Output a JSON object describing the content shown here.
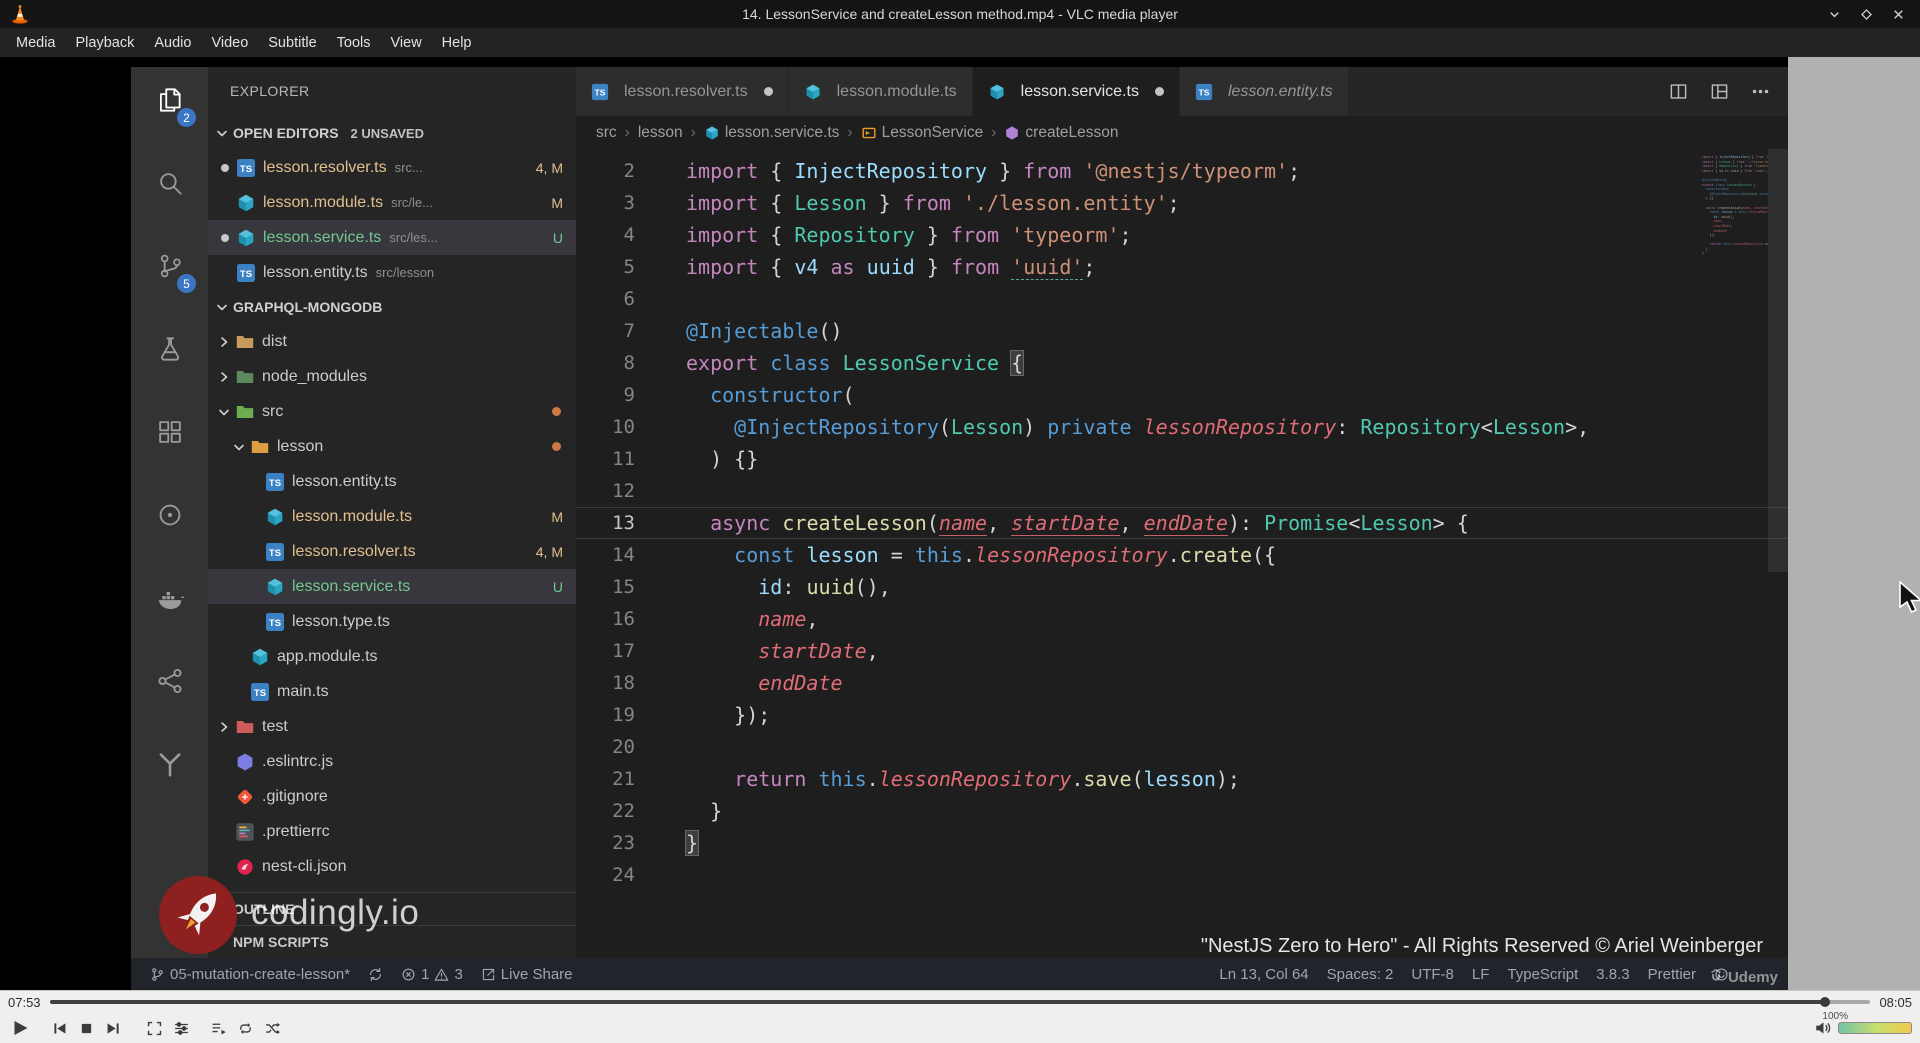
{
  "window": {
    "title": "14. LessonService and createLesson method.mp4 - VLC media player"
  },
  "menu_bar": [
    "Media",
    "Playback",
    "Audio",
    "Video",
    "Subtitle",
    "Tools",
    "View",
    "Help"
  ],
  "player": {
    "time_elapsed": "07:53",
    "time_total": "08:05",
    "progress_pct": 97.5,
    "volume_label": "100%",
    "controls": [
      "play",
      "previous",
      "stop",
      "next",
      "fullscreen",
      "extended-settings",
      "playlist",
      "loop",
      "random"
    ]
  },
  "overlays": {
    "codingly": "codingly.io",
    "copyright": "\"NestJS Zero to Hero\" - All Rights Reserved © Ariel Weinberger",
    "udemy": "Udemy"
  },
  "colors": {
    "badge_blue": "#3a76c4",
    "modified": "#e2c08d",
    "untracked": "#73c991",
    "selection": "#37373d"
  },
  "vscode": {
    "activity_bar": [
      {
        "icon": "files",
        "badge": "2",
        "active": true
      },
      {
        "icon": "search"
      },
      {
        "icon": "source-control",
        "badge": "5"
      },
      {
        "icon": "test-flask"
      },
      {
        "icon": "extensions"
      },
      {
        "icon": "circle-dot"
      },
      {
        "icon": "docker"
      },
      {
        "icon": "share-nodes"
      },
      {
        "icon": "terraform"
      }
    ],
    "explorer": {
      "title": "EXPLORER",
      "open_editors_label": "OPEN EDITORS",
      "unsaved_badge": "2 UNSAVED",
      "open_editors": [
        {
          "dirty": true,
          "icon": "ts-file",
          "name": "lesson.resolver.ts",
          "path": "src...",
          "badge": "4, M",
          "color": "mod"
        },
        {
          "dirty": false,
          "icon": "nest-file",
          "name": "lesson.module.ts",
          "path": "src/le...",
          "badge": "M",
          "color": "mod"
        },
        {
          "dirty": true,
          "icon": "nest-file",
          "name": "lesson.service.ts",
          "path": "src/les...",
          "badge": "U",
          "color": "unt",
          "selected": true
        },
        {
          "dirty": false,
          "icon": "ts-file",
          "name": "lesson.entity.ts",
          "path": "src/lesson",
          "badge": "",
          "color": "norm"
        }
      ],
      "project_label": "GRAPHQL-MONGODB",
      "tree": [
        {
          "indent": 0,
          "chevron": "right",
          "icon": "folder-dist",
          "name": "dist"
        },
        {
          "indent": 0,
          "chevron": "right",
          "icon": "folder-node-modules",
          "name": "node_modules"
        },
        {
          "indent": 0,
          "chevron": "down",
          "icon": "folder-src",
          "name": "src",
          "dot": true
        },
        {
          "indent": 1,
          "chevron": "down",
          "icon": "folder-lesson",
          "name": "lesson",
          "dot": true
        },
        {
          "indent": 2,
          "icon": "ts-file",
          "name": "lesson.entity.ts",
          "color": "norm"
        },
        {
          "indent": 2,
          "icon": "nest-file",
          "name": "lesson.module.ts",
          "badge": "M",
          "color": "mod"
        },
        {
          "indent": 2,
          "icon": "ts-file",
          "name": "lesson.resolver.ts",
          "badge": "4, M",
          "color": "mod"
        },
        {
          "indent": 2,
          "icon": "nest-file",
          "name": "lesson.service.ts",
          "badge": "U",
          "color": "unt",
          "selected": true
        },
        {
          "indent": 2,
          "icon": "ts-file",
          "name": "lesson.type.ts",
          "color": "norm"
        },
        {
          "indent": 1,
          "icon": "nest-file",
          "name": "app.module.ts",
          "color": "norm"
        },
        {
          "indent": 1,
          "icon": "ts-file",
          "name": "main.ts",
          "color": "norm"
        },
        {
          "indent": 0,
          "chevron": "right",
          "icon": "folder-test",
          "name": "test"
        },
        {
          "indent": 0,
          "icon": "eslint-file",
          "name": ".eslintrc.js",
          "color": "norm"
        },
        {
          "indent": 0,
          "icon": "git-file",
          "name": ".gitignore",
          "color": "norm"
        },
        {
          "indent": 0,
          "icon": "prettier-file",
          "name": ".prettierrc",
          "color": "norm"
        },
        {
          "indent": 0,
          "icon": "nest-cli-file",
          "name": "nest-cli.json",
          "color": "norm"
        }
      ],
      "bottom_sections": [
        "OUTLINE",
        "NPM SCRIPTS"
      ]
    },
    "tabs": [
      {
        "icon": "ts-file",
        "label": "lesson.resolver.ts",
        "dirty": true
      },
      {
        "icon": "nest-file",
        "label": "lesson.module.ts"
      },
      {
        "icon": "nest-file",
        "label": "lesson.service.ts",
        "dirty": true,
        "active": true
      },
      {
        "icon": "ts-file",
        "label": "lesson.entity.ts",
        "preview": true
      }
    ],
    "breadcrumbs": [
      {
        "label": "src"
      },
      {
        "label": "lesson"
      },
      {
        "label": "lesson.service.ts",
        "icon": "nest-file"
      },
      {
        "label": "LessonService",
        "icon": "symbol-class"
      },
      {
        "label": "createLesson",
        "icon": "symbol-method"
      }
    ],
    "editor": {
      "current_line": 13,
      "lines": [
        {
          "n": 2,
          "t": [
            [
              "import",
              "k1"
            ],
            [
              " { ",
              "pu"
            ],
            [
              "InjectRepository",
              "vb"
            ],
            [
              " } ",
              "pu"
            ],
            [
              "from",
              "k1"
            ],
            [
              " ",
              "pu"
            ],
            [
              "'@nestjs/typeorm'",
              "st"
            ],
            [
              ";",
              "pu"
            ]
          ]
        },
        {
          "n": 3,
          "t": [
            [
              "import",
              "k1"
            ],
            [
              " { ",
              "pu"
            ],
            [
              "Lesson",
              "ty"
            ],
            [
              " } ",
              "pu"
            ],
            [
              "from",
              "k1"
            ],
            [
              " ",
              "pu"
            ],
            [
              "'./lesson.entity'",
              "st"
            ],
            [
              ";",
              "pu"
            ]
          ]
        },
        {
          "n": 4,
          "t": [
            [
              "import",
              "k1"
            ],
            [
              " { ",
              "pu"
            ],
            [
              "Repository",
              "ty"
            ],
            [
              " } ",
              "pu"
            ],
            [
              "from",
              "k1"
            ],
            [
              " ",
              "pu"
            ],
            [
              "'typeorm'",
              "st"
            ],
            [
              ";",
              "pu"
            ]
          ]
        },
        {
          "n": 5,
          "t": [
            [
              "import",
              "k1"
            ],
            [
              " { ",
              "pu"
            ],
            [
              "v4",
              "vb"
            ],
            [
              " ",
              "pu"
            ],
            [
              "as",
              "k1"
            ],
            [
              " ",
              "pu"
            ],
            [
              "uuid",
              "vb"
            ],
            [
              " } ",
              "pu"
            ],
            [
              "from",
              "k1"
            ],
            [
              " ",
              "pu"
            ],
            [
              "'uuid'",
              "st",
              "q"
            ],
            [
              ";",
              "pu"
            ]
          ]
        },
        {
          "n": 6,
          "t": []
        },
        {
          "n": 7,
          "t": [
            [
              "@Injectable",
              "k2"
            ],
            [
              "()",
              "pu"
            ]
          ]
        },
        {
          "n": 8,
          "t": [
            [
              "export",
              "k1"
            ],
            [
              " ",
              "pu"
            ],
            [
              "class",
              "k2"
            ],
            [
              " ",
              "pu"
            ],
            [
              "LessonService",
              "ty"
            ],
            [
              " ",
              "pu"
            ],
            [
              "{",
              "pu",
              "x"
            ]
          ]
        },
        {
          "n": 9,
          "t": [
            [
              "  ",
              "pu"
            ],
            [
              "constructor",
              "k2"
            ],
            [
              "(",
              "pu"
            ]
          ]
        },
        {
          "n": 10,
          "t": [
            [
              "    ",
              "pu"
            ],
            [
              "@InjectRepository",
              "k2"
            ],
            [
              "(",
              "pu"
            ],
            [
              "Lesson",
              "ty"
            ],
            [
              ") ",
              "pu"
            ],
            [
              "private",
              "k2"
            ],
            [
              " ",
              "pu"
            ],
            [
              "lessonRepository",
              "pr",
              "i"
            ],
            [
              ": ",
              "pu"
            ],
            [
              "Repository",
              "ty"
            ],
            [
              "<",
              "pu"
            ],
            [
              "Lesson",
              "ty"
            ],
            [
              ">,",
              "pu"
            ]
          ]
        },
        {
          "n": 11,
          "t": [
            [
              "  ) {}",
              "pu"
            ]
          ]
        },
        {
          "n": 12,
          "t": []
        },
        {
          "n": 13,
          "t": [
            [
              "  ",
              "pu"
            ],
            [
              "async",
              "k1"
            ],
            [
              " ",
              "pu"
            ],
            [
              "createLesson",
              "fn"
            ],
            [
              "(",
              "pu"
            ],
            [
              "name",
              "pr",
              "iu"
            ],
            [
              ", ",
              "pu"
            ],
            [
              "startDate",
              "pr",
              "iu"
            ],
            [
              ", ",
              "pu"
            ],
            [
              "endDate",
              "pr",
              "iu"
            ],
            [
              "): ",
              "pu"
            ],
            [
              "Promise",
              "ty"
            ],
            [
              "<",
              "pu"
            ],
            [
              "Lesson",
              "ty"
            ],
            [
              "> ",
              "pu"
            ],
            [
              "{",
              "pu"
            ]
          ]
        },
        {
          "n": 14,
          "t": [
            [
              "    ",
              "pu"
            ],
            [
              "const",
              "k2"
            ],
            [
              " ",
              "pu"
            ],
            [
              "lesson",
              "vb"
            ],
            [
              " = ",
              "pu"
            ],
            [
              "this",
              "k2"
            ],
            [
              ".",
              "pu"
            ],
            [
              "lessonRepository",
              "pr",
              "i"
            ],
            [
              ".",
              "pu"
            ],
            [
              "create",
              "fn"
            ],
            [
              "({",
              "pu"
            ]
          ]
        },
        {
          "n": 15,
          "t": [
            [
              "      ",
              "pu"
            ],
            [
              "id",
              "vb"
            ],
            [
              ": ",
              "pu"
            ],
            [
              "uuid",
              "fn"
            ],
            [
              "(),",
              "pu"
            ]
          ]
        },
        {
          "n": 16,
          "t": [
            [
              "      ",
              "pu"
            ],
            [
              "name",
              "pr",
              "i"
            ],
            [
              ",",
              "pu"
            ]
          ]
        },
        {
          "n": 17,
          "t": [
            [
              "      ",
              "pu"
            ],
            [
              "startDate",
              "pr",
              "i"
            ],
            [
              ",",
              "pu"
            ]
          ]
        },
        {
          "n": 18,
          "t": [
            [
              "      ",
              "pu"
            ],
            [
              "endDate",
              "pr",
              "i"
            ]
          ]
        },
        {
          "n": 19,
          "t": [
            [
              "    });",
              "pu"
            ]
          ]
        },
        {
          "n": 20,
          "t": []
        },
        {
          "n": 21,
          "t": [
            [
              "    ",
              "pu"
            ],
            [
              "return",
              "k1"
            ],
            [
              " ",
              "pu"
            ],
            [
              "this",
              "k2"
            ],
            [
              ".",
              "pu"
            ],
            [
              "lessonRepository",
              "pr",
              "i"
            ],
            [
              ".",
              "pu"
            ],
            [
              "save",
              "fn"
            ],
            [
              "(",
              "pu"
            ],
            [
              "lesson",
              "vb"
            ],
            [
              ");",
              "pu"
            ]
          ]
        },
        {
          "n": 22,
          "t": [
            [
              "  }",
              "pu"
            ]
          ]
        },
        {
          "n": 23,
          "t": [
            [
              "}",
              "pu",
              "x"
            ]
          ]
        },
        {
          "n": 24,
          "t": []
        }
      ]
    },
    "status_bar": {
      "left": [
        {
          "name": "branch",
          "icon": "branch",
          "label": "05-mutation-create-lesson*"
        },
        {
          "name": "sync",
          "icon": "sync",
          "label": ""
        },
        {
          "name": "problems",
          "parts": [
            {
              "icon": "error",
              "label": "1"
            },
            {
              "icon": "warning",
              "label": "3"
            }
          ]
        },
        {
          "name": "live-share",
          "icon": "live-share",
          "label": "Live Share"
        }
      ],
      "right": [
        {
          "name": "cursor-position",
          "label": "Ln 13, Col 64"
        },
        {
          "name": "indentation",
          "label": "Spaces: 2"
        },
        {
          "name": "encoding",
          "label": "UTF-8"
        },
        {
          "name": "eol",
          "label": "LF"
        },
        {
          "name": "language",
          "label": "TypeScript"
        },
        {
          "name": "version",
          "label": "3.8.3"
        },
        {
          "name": "formatter",
          "label": "Prettier"
        },
        {
          "name": "feedback",
          "icon": "smiley",
          "label": ""
        }
      ]
    }
  }
}
